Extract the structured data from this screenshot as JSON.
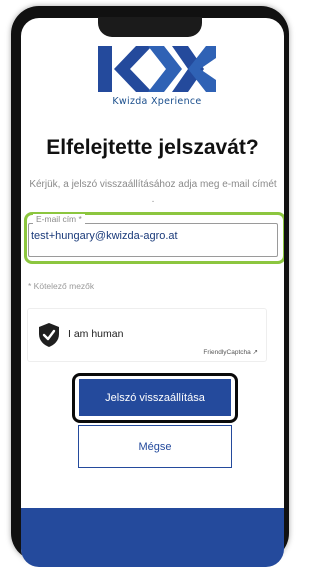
{
  "brand": {
    "logo_text": "Kwizda Xperience",
    "primary_color": "#244a9c",
    "highlight_color": "#8cc63f"
  },
  "page": {
    "title": "Elfelejtette jelszavát?",
    "subtitle": "Kérjük, a jelszó visszaállításához adja meg e-mail címét ."
  },
  "form": {
    "email_label": "E-mail cím *",
    "email_value": "test+hungary@kwizda-agro.at",
    "required_note": "* Kötelező mezők"
  },
  "captcha": {
    "label": "I am human",
    "brand": "FriendlyCaptcha ↗"
  },
  "buttons": {
    "reset": "Jelszó visszaállítása",
    "cancel": "Mégse"
  }
}
